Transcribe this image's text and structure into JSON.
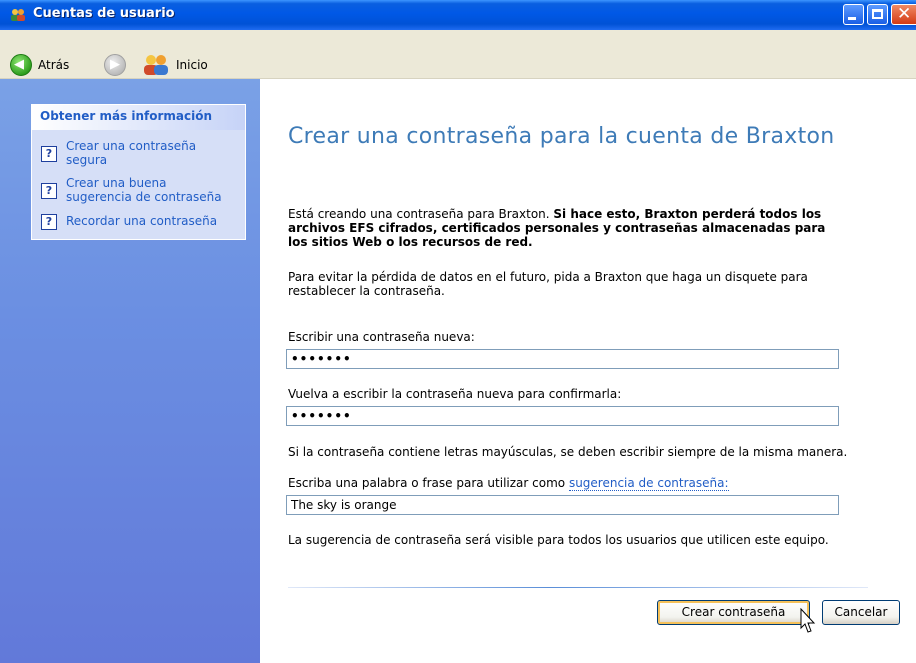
{
  "window": {
    "title": "Cuentas de usuario",
    "controls": {
      "minimize_icon": "minimize-icon",
      "maximize_icon": "maximize-icon",
      "close_icon": "close-icon",
      "close_glyph": "✕"
    }
  },
  "toolbar": {
    "back_label": "Atrás",
    "home_label": "Inicio",
    "back_glyph": "◀",
    "forward_glyph": "▶"
  },
  "sidebar": {
    "panel_title": "Obtener más información",
    "help_glyph": "?",
    "links": [
      "Crear una contraseña segura",
      "Crear una buena sugerencia de contraseña",
      "Recordar una contraseña"
    ]
  },
  "main": {
    "title": "Crear una contraseña para la cuenta de Braxton",
    "warning_intro": "Está creando una contraseña para Braxton. ",
    "warning_bold": "Si hace esto, Braxton perderá todos los archivos EFS cifrados, certificados personales y contraseñas almacenadas para los sitios Web o los recursos de red.",
    "advice": "Para evitar la pérdida de datos en el futuro, pida a Braxton que haga un disquete para restablecer la contraseña.",
    "new_password_label": "Escribir una contraseña nueva:",
    "new_password_value": "•••••••",
    "confirm_password_label": "Vuelva a escribir la contraseña nueva para confirmarla:",
    "confirm_password_value": "•••••••",
    "case_note": "Si la contraseña contiene letras mayúsculas, se deben escribir siempre de la misma manera.",
    "hint_label_prefix": "Escriba una palabra o frase para utilizar como ",
    "hint_label_link": "sugerencia de contraseña:",
    "hint_value": "The sky is orange",
    "hint_note": "La sugerencia de contraseña será visible para todos los usuarios que utilicen este equipo."
  },
  "buttons": {
    "create": "Crear contraseña",
    "cancel": "Cancelar"
  },
  "colors": {
    "titlebar": "#0058e6",
    "sidebar": "#6b8fe2",
    "heading": "#3e7bb7",
    "link": "#215dc6"
  }
}
